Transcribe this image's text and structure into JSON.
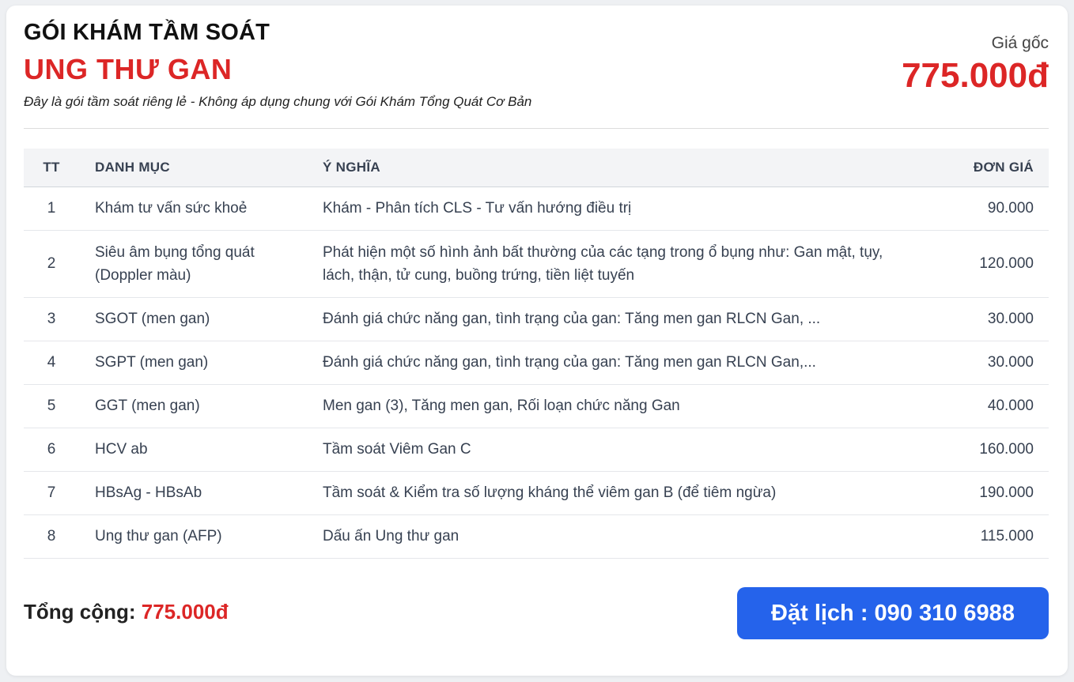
{
  "header": {
    "title_line1": "GÓI KHÁM TẦM SOÁT",
    "title_line2": "UNG THƯ GAN",
    "subtitle": "Đây là gói tầm soát riêng lẻ - Không áp dụng chung với Gói Khám Tổng Quát Cơ Bản",
    "price_label": "Giá gốc",
    "price_value": "775.000đ"
  },
  "table": {
    "headers": {
      "tt": "TT",
      "name": "DANH MỤC",
      "meaning": "Ý NGHĨA",
      "price": "ĐƠN GIÁ"
    },
    "rows": [
      {
        "tt": "1",
        "name": "Khám tư vấn sức khoẻ",
        "meaning": "Khám - Phân tích CLS - Tư vấn hướng điều trị",
        "price": "90.000"
      },
      {
        "tt": "2",
        "name": "Siêu âm bụng tổng quát (Doppler màu)",
        "meaning": "Phát hiện một số hình ảnh bất thường của các tạng trong ổ bụng như: Gan mật, tụy, lách, thận, tử cung, buồng trứng, tiền liệt tuyến",
        "price": "120.000"
      },
      {
        "tt": "3",
        "name": "SGOT (men gan)",
        "meaning": "Đánh giá chức năng gan, tình trạng của gan: Tăng men gan RLCN Gan, ...",
        "price": "30.000"
      },
      {
        "tt": "4",
        "name": "SGPT (men gan)",
        "meaning": "Đánh giá chức năng gan, tình trạng của gan: Tăng men gan RLCN Gan,...",
        "price": "30.000"
      },
      {
        "tt": "5",
        "name": "GGT (men gan)",
        "meaning": "Men gan (3), Tăng men gan, Rối loạn chức năng Gan",
        "price": "40.000"
      },
      {
        "tt": "6",
        "name": "HCV ab",
        "meaning": "Tầm soát Viêm Gan C",
        "price": "160.000"
      },
      {
        "tt": "7",
        "name": "HBsAg - HBsAb",
        "meaning": "Tầm soát & Kiểm tra số lượng kháng thể viêm gan B (để tiêm ngừa)",
        "price": "190.000"
      },
      {
        "tt": "8",
        "name": "Ung thư gan (AFP)",
        "meaning": "Dấu ấn Ung thư gan",
        "price": "115.000"
      }
    ]
  },
  "footer": {
    "total_label": "Tổng cộng:",
    "total_value": "775.000đ",
    "book_label": "Đặt lịch : 090 310 6988"
  },
  "colors": {
    "accent_red": "#dc2626",
    "button_blue": "#2563eb"
  }
}
